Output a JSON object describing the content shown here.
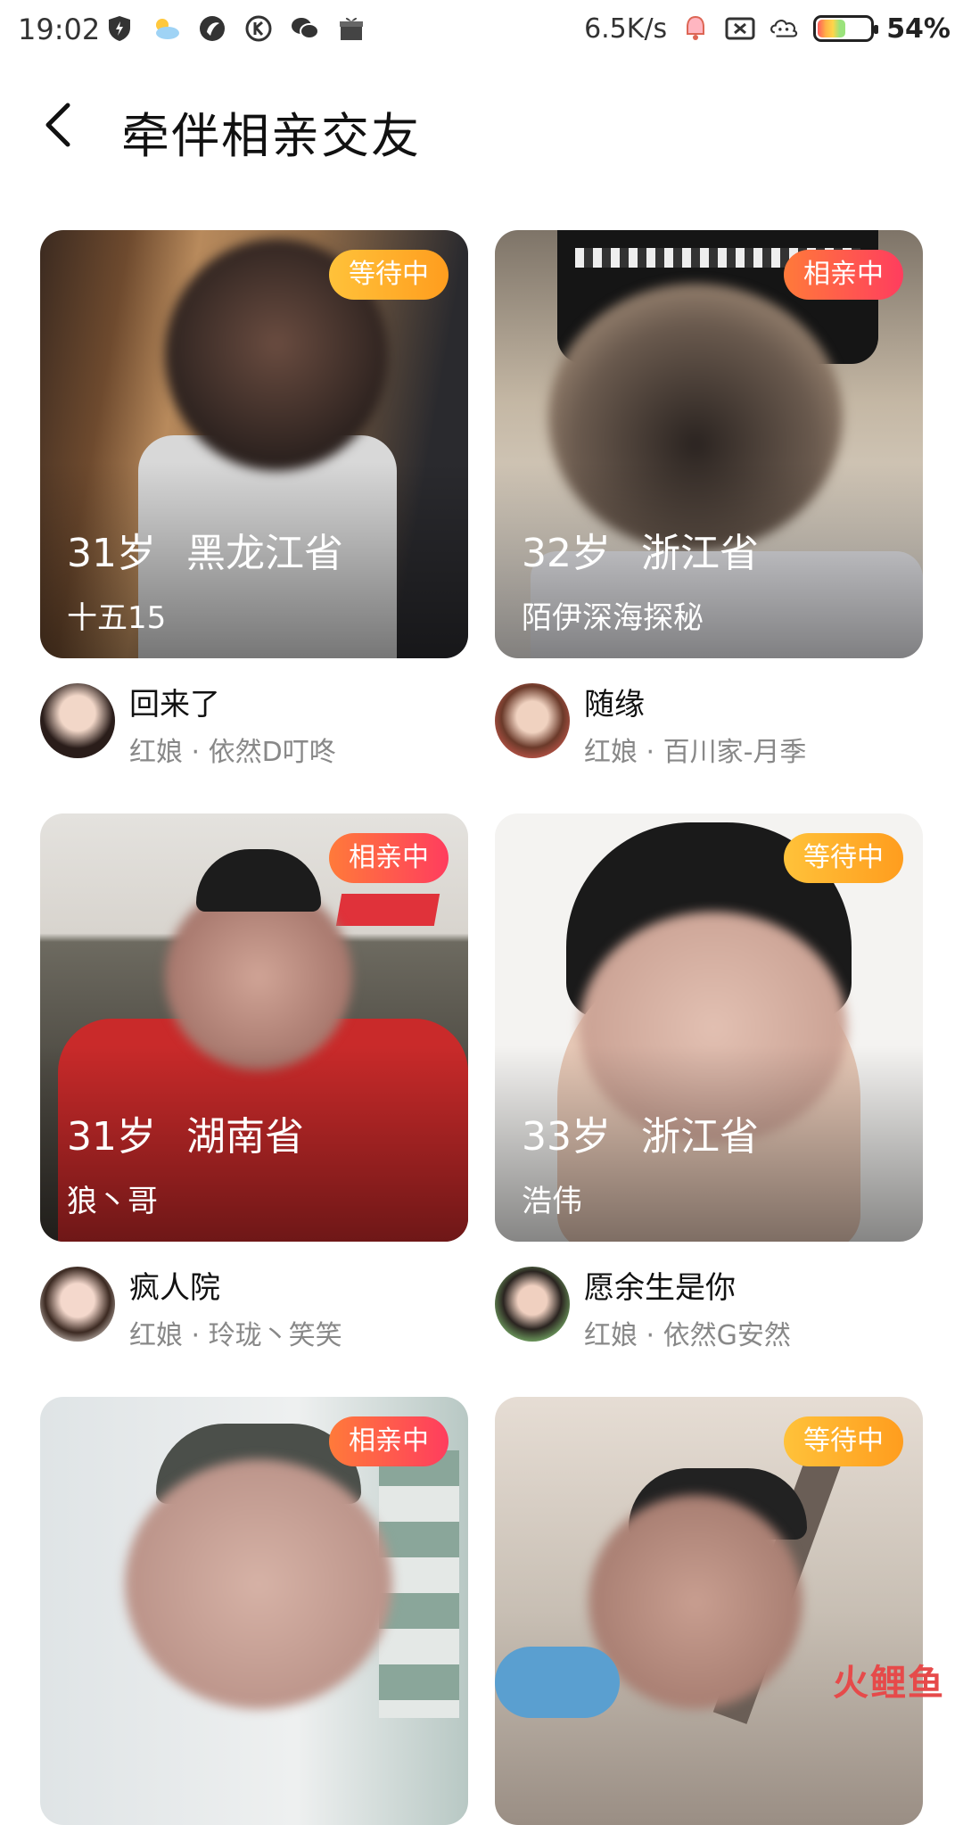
{
  "status_bar": {
    "time": "19:02",
    "net_speed": "6.5K/s",
    "battery": "54%",
    "battery_level": 0.54,
    "icons": [
      "shield-icon",
      "weather-icon",
      "app-icon",
      "k-icon",
      "wechat-icon",
      "gift-icon",
      "bell-icon",
      "signal-x-icon",
      "cloud-icon",
      "battery-icon"
    ]
  },
  "header": {
    "title": "牵伴相亲交友"
  },
  "cards": [
    {
      "badge": "等待中",
      "badge_type": "wait",
      "age": "31岁",
      "province": "黑龙江省",
      "nickname": "十五15",
      "author": "回来了",
      "matchmaker": "红娘 · 依然D叮咚"
    },
    {
      "badge": "相亲中",
      "badge_type": "date",
      "age": "32岁",
      "province": "浙江省",
      "nickname": "陌伊深海探秘",
      "author": "随缘",
      "matchmaker": "红娘 · 百川家-月季"
    },
    {
      "badge": "相亲中",
      "badge_type": "date",
      "age": "31岁",
      "province": "湖南省",
      "nickname": "狼丶哥",
      "author": "疯人院",
      "matchmaker": "红娘 · 玲珑丶笑笑"
    },
    {
      "badge": "等待中",
      "badge_type": "wait",
      "age": "33岁",
      "province": "浙江省",
      "nickname": "浩伟",
      "author": "愿余生是你",
      "matchmaker": "红娘 · 依然G安然"
    },
    {
      "badge": "相亲中",
      "badge_type": "date"
    },
    {
      "badge": "等待中",
      "badge_type": "wait"
    }
  ],
  "watermark": "火鲤鱼",
  "colors": {
    "badge_wait": "#ffb02e",
    "badge_date": "#ff5a4a",
    "subtext": "#888888"
  }
}
